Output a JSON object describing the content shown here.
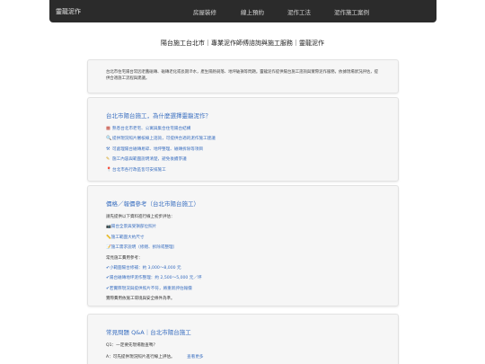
{
  "nav": {
    "brand": "靈龍泥作",
    "links": [
      "房屋裝修",
      "線上預約",
      "泥作工法",
      "泥作施工案例"
    ]
  },
  "page_title": "陽台施工台北市｜專業泥作師傅諮詢與施工服務｜靈龍泥作",
  "intro": {
    "text": "台北市住宅陽台常因老舊磁磚、磁磚老化或長期滲水，產生隔熱剝落、地坪破損等問題。靈龍泥作提供陽台施工諮詢與實際泥作服務，依據現場狀況評估，提供合適施工流程與建議。"
  },
  "why": {
    "title": "台北市陽台施工，為什麼選擇靈龍泥作？",
    "items": [
      {
        "icon": "brick-icon",
        "glyph": "▩",
        "color": "#c0392b",
        "text": "熟悉台北市老宅、公寓與集合住宅陽台結構"
      },
      {
        "icon": "magnifier-icon",
        "glyph": "🔍",
        "color": "#3a6fc0",
        "text": "提供現況照片審核線上諮詢，可提供合適的泥作施工建議"
      },
      {
        "icon": "tools-icon",
        "glyph": "⚒",
        "color": "#3a6fc0",
        "text": "可處理陽台磁磚易碎、地坪整理、磁磚拆除等項目"
      },
      {
        "icon": "pencil-icon",
        "glyph": "✎",
        "color": "#d4a017",
        "text": "施工內容與範圍說明清楚，避免後續爭議"
      },
      {
        "icon": "pin-icon",
        "glyph": "📍",
        "color": "#c0392b",
        "text": "台北市各行政區皆可安排施工"
      }
    ]
  },
  "price": {
    "title": "價格／報價參考（台北市陽台施工）",
    "sub1": "請先提供以下資料進行線上初步評估：",
    "items1": [
      {
        "icon": "camera-icon",
        "glyph": "📷",
        "text": "陽台全景與受損部位照片"
      },
      {
        "icon": "ruler-icon",
        "glyph": "📏",
        "text": "施工範圍大約尺寸"
      },
      {
        "icon": "note-icon",
        "glyph": "📝",
        "text": "施工需求說明（修繕、拆除或整理）"
      }
    ],
    "sub2": "常見施工費用參考：",
    "items2": [
      {
        "icon": "check-icon",
        "glyph": "✔",
        "text": "小範圍陽台修補：約 3,000～8,000 元"
      },
      {
        "icon": "check-icon",
        "glyph": "✔",
        "text": "陽台磁磚地坪泥作整理：約 2,500～5,000 元／坪"
      },
      {
        "icon": "check-icon",
        "glyph": "✔",
        "text": "若實際現況與提供照片不符，將重新評估報價"
      }
    ],
    "footer": "實際費用依施工環境與安全條件為準。"
  },
  "faq": {
    "title": "常見問題 Q&A｜台北市陽台施工",
    "q1": "Q1：一定要先現場勘查嗎？",
    "a1": "A：可先提供現況照片進行線上評估。",
    "more": "查看更多"
  }
}
